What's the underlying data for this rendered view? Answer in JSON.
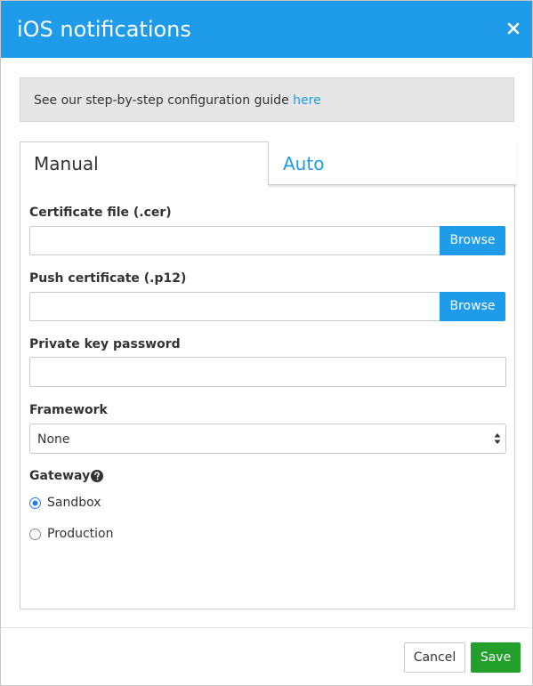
{
  "dialog": {
    "title": "iOS notifications"
  },
  "info": {
    "text": "See our step-by-step configuration guide ",
    "link_label": "here"
  },
  "tabs": [
    {
      "label": "Manual",
      "active": true
    },
    {
      "label": "Auto",
      "active": false
    }
  ],
  "form": {
    "certificate_file": {
      "label": "Certificate file (.cer)",
      "value": "",
      "browse_label": "Browse"
    },
    "push_certificate": {
      "label": "Push certificate (.p12)",
      "value": "",
      "browse_label": "Browse"
    },
    "private_key_password": {
      "label": "Private key password",
      "value": ""
    },
    "framework": {
      "label": "Framework",
      "selected": "None"
    },
    "gateway": {
      "label": "Gateway",
      "options": [
        {
          "label": "Sandbox",
          "checked": true
        },
        {
          "label": "Production",
          "checked": false
        }
      ]
    }
  },
  "footer": {
    "cancel_label": "Cancel",
    "save_label": "Save"
  },
  "colors": {
    "header": "#1e9be9",
    "accent": "#1e9be9",
    "save": "#23a02b"
  },
  "icons": {
    "close": "close-icon",
    "help": "question-circle-icon",
    "select_arrows": "select-arrows-icon"
  }
}
